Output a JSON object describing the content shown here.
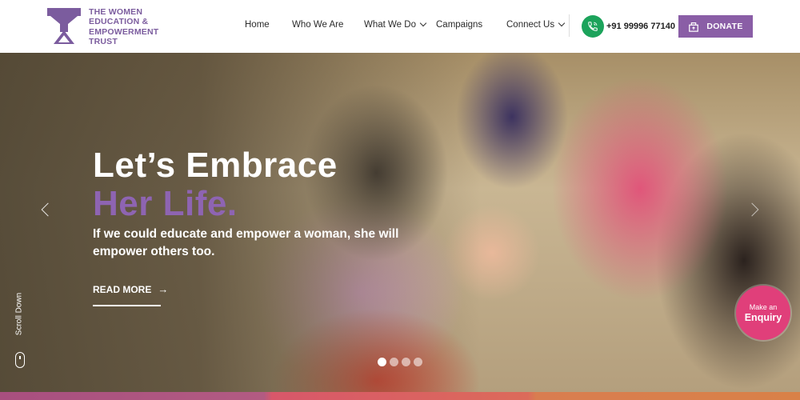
{
  "brand": {
    "name_lines": [
      "THE WOMEN",
      "EDUCATION &",
      "EMPOWERMENT",
      "TRUST"
    ],
    "logo_icon": "tweet-logo-icon",
    "color": "#7b5c9e"
  },
  "nav": {
    "items": [
      {
        "label": "Home",
        "has_dropdown": false
      },
      {
        "label": "Who We Are",
        "has_dropdown": false
      },
      {
        "label": "What We Do",
        "has_dropdown": true
      },
      {
        "label": "Campaigns",
        "has_dropdown": false
      },
      {
        "label": "Connect Us",
        "has_dropdown": true
      }
    ]
  },
  "contact": {
    "phone": "+91 99996 77140",
    "icon": "phone-icon",
    "icon_color": "#1ca35b"
  },
  "donate": {
    "label": "DONATE",
    "icon": "donate-box-icon",
    "color": "#8a5ea6"
  },
  "hero": {
    "title_line1": "Let’s Embrace",
    "title_line2": "Her Life.",
    "subtitle": "If we could educate and empower a woman, she will empower others too.",
    "cta_label": "READ MORE",
    "cta_arrow": "→",
    "scroll_label": "Scroll Down",
    "accent_color": "#8e64b2",
    "slides_count": 4,
    "active_slide": 1
  },
  "enquiry": {
    "line1": "Make an",
    "line2": "Enquiry",
    "color": "#e03f7a"
  }
}
